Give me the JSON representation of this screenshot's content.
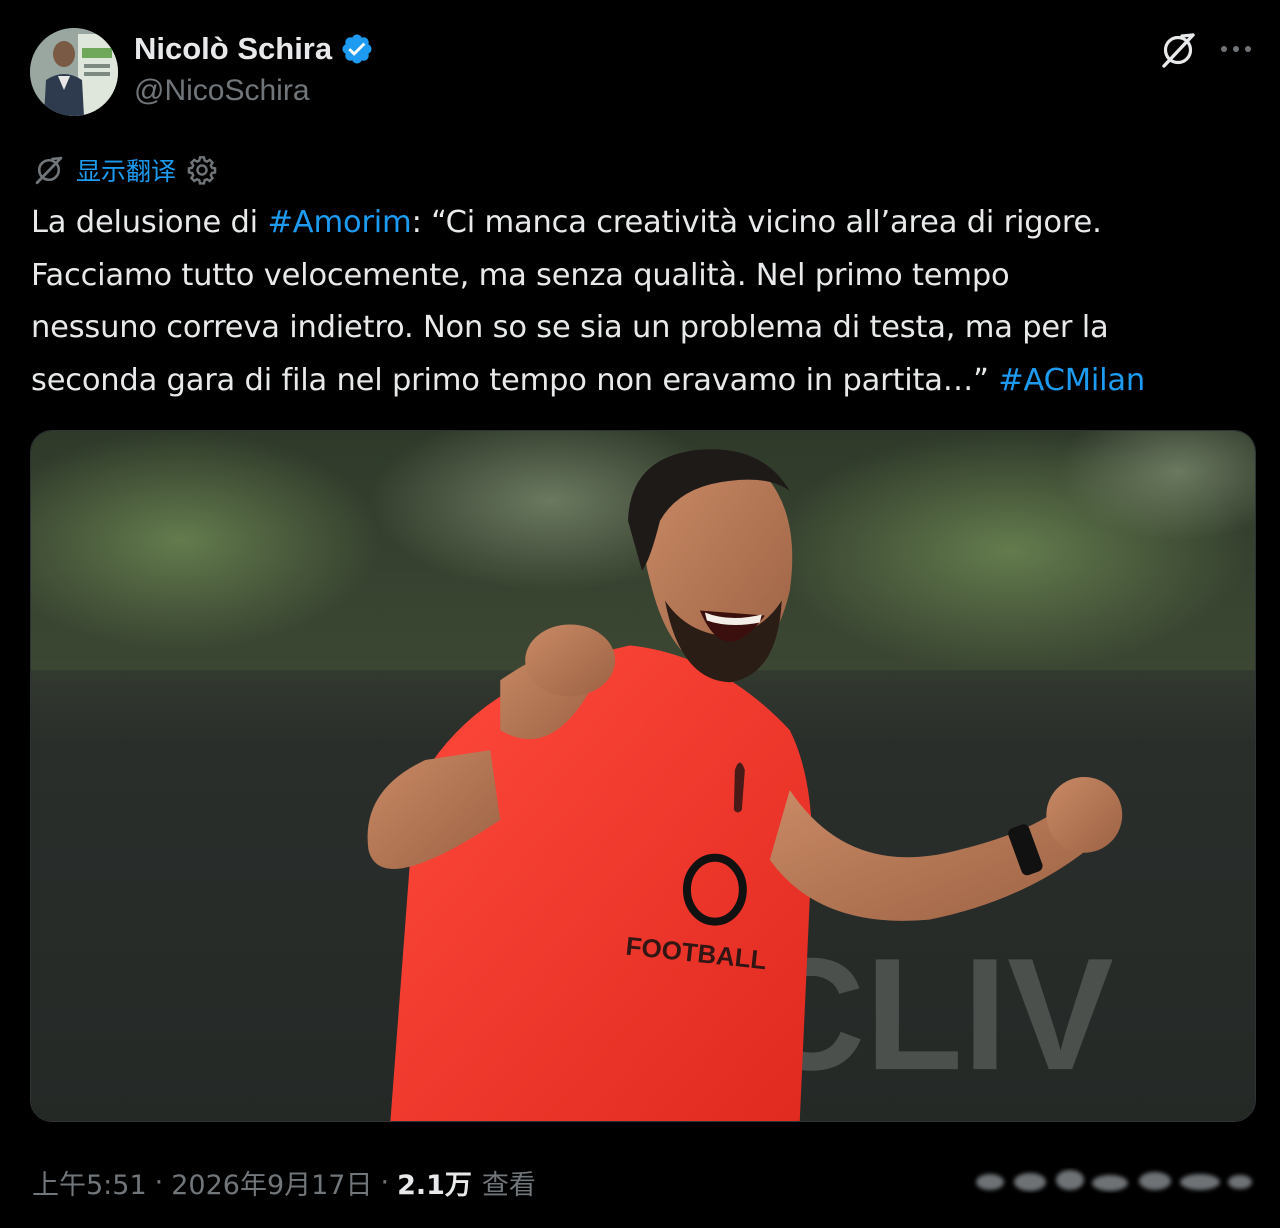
{
  "author": {
    "display_name": "Nicolò Schira",
    "handle": "@NicoSchira",
    "verified": true,
    "verified_color": "#1d9bf0"
  },
  "header_icons": {
    "grok": "grok-icon",
    "more": "more-icon"
  },
  "translate": {
    "label": "显示翻译",
    "left_icon": "translate-icon",
    "right_icon": "gear-icon"
  },
  "tweet": {
    "line1_a": "La delusione di ",
    "hashtag1": "#Amorim",
    "line1_b": ": “Ci manca creatività vicino all’area di rigore.",
    "line2": "Facciamo tutto velocemente, ma senza qualità. Nel primo tempo",
    "line3": "nessuno correva indietro. Non so se sia un problema di testa, ma per la",
    "line4_a": "seconda gara di fila nel primo tempo non eravamo in partita…” ",
    "hashtag2": "#ACMilan"
  },
  "media": {
    "shirt_text": "FOOTBALL",
    "background_text": "CLIV"
  },
  "meta": {
    "time": "上午5:51",
    "separator": "·",
    "date": "2026年9月17日",
    "views_count": "2.1万",
    "views_label": "查看"
  },
  "colors": {
    "background": "#000000",
    "text": "#e7e9ea",
    "secondary": "#71767b",
    "accent": "#1d9bf0"
  }
}
